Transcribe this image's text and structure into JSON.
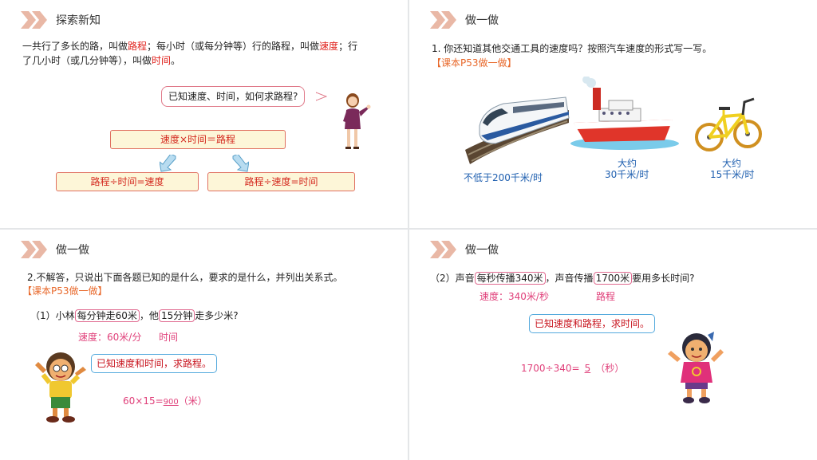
{
  "panel1": {
    "heading": "探索新知",
    "para_line1": [
      "一共行了多长的路，叫做",
      "路程",
      "；每小时（或每分钟等）行的路程，叫做",
      "速度",
      "；行"
    ],
    "para_line2": [
      "了几小时（或几分钟等），叫做",
      "时间",
      "。"
    ],
    "question": "已知速度、时间，如何求路程?",
    "formula_main": "速度×时间＝路程",
    "formula_left": "路程÷时间=速度",
    "formula_right": "路程÷速度=时间"
  },
  "panel2": {
    "heading": "做一做",
    "question": "1. 你还知道其他交通工具的速度吗？按照汽车速度的形式写一写。",
    "ref": "【课本P53做一做】",
    "train_speed": "不低于200千米/时",
    "ship_label": "大约",
    "ship_speed": "30千米/时",
    "bike_label": "大约",
    "bike_speed": "15千米/时"
  },
  "panel3": {
    "heading": "做一做",
    "question": "2.不解答，只说出下面各题已知的是什么，要求的是什么，并列出关系式。",
    "ref": "【课本P53做一做】",
    "sub_prefix": "（1）小林",
    "sub_box1": "每分钟走60米",
    "sub_mid": "，他",
    "sub_box2": "15分钟",
    "sub_suffix": "走多少米?",
    "note_speed": "速度：60米/分",
    "note_time": "时间",
    "bubble": "已知速度和时间，求路程。",
    "calc_prefix": "60×15=",
    "calc_answer": "900",
    "calc_unit": "（米）"
  },
  "panel4": {
    "heading": "做一做",
    "q_prefix": "（2）声音",
    "q_box1": "每秒传播340米",
    "q_mid": "，声音传播",
    "q_box2": "1700米",
    "q_suffix": "要用多长时间?",
    "note_speed": "速度：340米/秒",
    "note_distance": "路程",
    "bubble": "已知速度和路程，求时间。",
    "calc_prefix": "1700÷340=",
    "calc_answer": "5",
    "calc_unit": "（秒）"
  },
  "colors": {
    "red": "#e0201b",
    "orange": "#e8682a",
    "pink": "#e0407a",
    "blue": "#2060b0",
    "arrow": "#e8a890"
  }
}
